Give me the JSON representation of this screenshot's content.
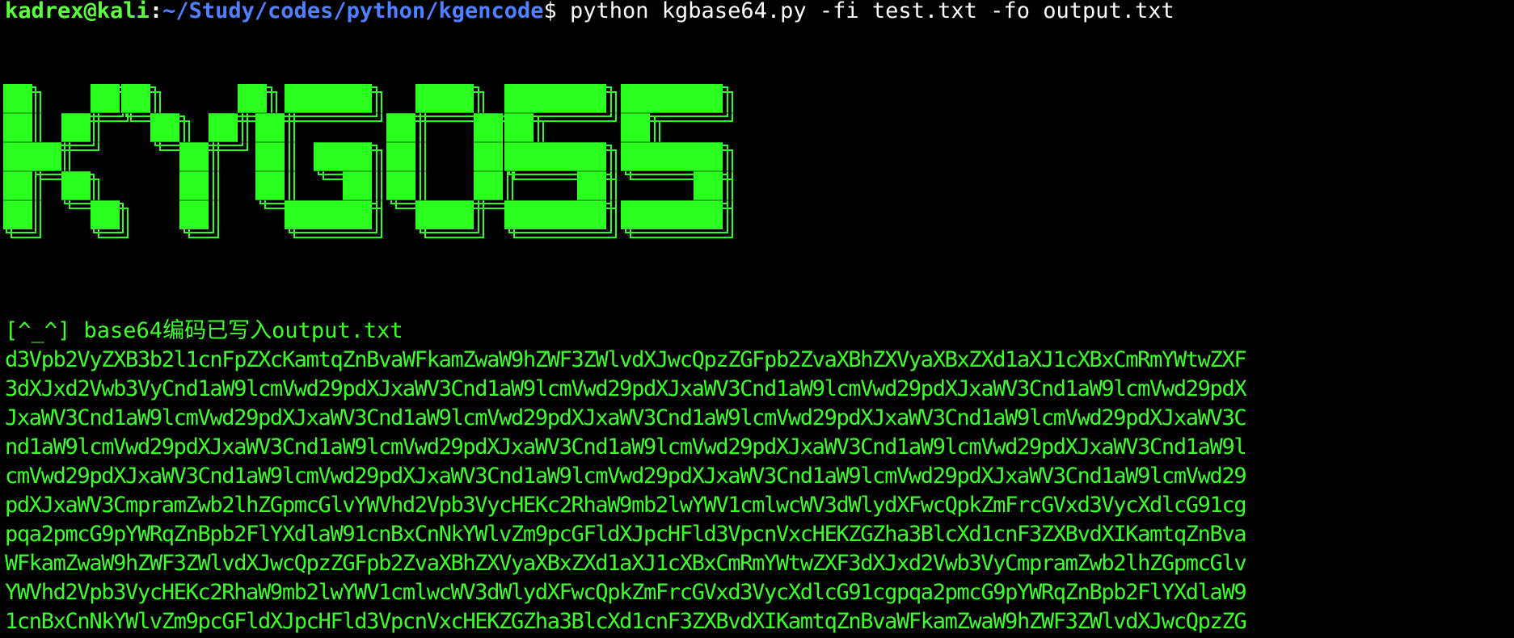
{
  "terminal": {
    "prompt": {
      "user_host": "kadrex@kali",
      "sep": ":",
      "path": "~/Study/codes/python/kgencode",
      "dollar": "$",
      "command": " python kgbase64.py -fi test.txt -fo output.txt"
    },
    "banner": {
      "text": "KYGOSS",
      "color": "#2aff20"
    },
    "status": "[^_^] base64编码已写入output.txt",
    "output_lines": [
      "d3Vpb2VyZXB3b2l1cnFpZXcKamtqZnBvaWFkamZwaW9hZWF3ZWlvdXJwcQpzZGFpb2ZvaXBhZXVyaXBxZXd1aXJ1cXBxCmRmYWtwZXF",
      "3dXJxd2Vwb3VyCnd1aW9lcmVwd29pdXJxaWV3Cnd1aW9lcmVwd29pdXJxaWV3Cnd1aW9lcmVwd29pdXJxaWV3Cnd1aW9lcmVwd29pdX",
      "JxaWV3Cnd1aW9lcmVwd29pdXJxaWV3Cnd1aW9lcmVwd29pdXJxaWV3Cnd1aW9lcmVwd29pdXJxaWV3Cnd1aW9lcmVwd29pdXJxaWV3C",
      "nd1aW9lcmVwd29pdXJxaWV3Cnd1aW9lcmVwd29pdXJxaWV3Cnd1aW9lcmVwd29pdXJxaWV3Cnd1aW9lcmVwd29pdXJxaWV3Cnd1aW9l",
      "cmVwd29pdXJxaWV3Cnd1aW9lcmVwd29pdXJxaWV3Cnd1aW9lcmVwd29pdXJxaWV3Cnd1aW9lcmVwd29pdXJxaWV3Cnd1aW9lcmVwd29",
      "pdXJxaWV3CmpramZwb2lhZGpmcGlvYWVhd2Vpb3VycHEKc2RhaW9mb2lwYWV1cmlwcWV3dWlydXFwcQpkZmFrcGVxd3VycXdlcG91cg",
      "pqa2pmcG9pYWRqZnBpb2FlYXdlaW91cnBxCnNkYWlvZm9pcGFldXJpcHFld3VpcnVxcHEKZGZha3BlcXd1cnF3ZXBvdXIKamtqZnBva",
      "WFkamZwaW9hZWF3ZWlvdXJwcQpzZGFpb2ZvaXBhZXVyaXBxZXd1aXJ1cXBxCmRmYWtwZXF3dXJxd2Vwb3VyCmpramZwb2lhZGpmcGlv",
      "YWVhd2Vpb3VycHEKc2RhaW9mb2lwYWV1cmlwcWV3dWlydXFwcQpkZmFrcGVxd3VycXdlcG91cgpqa2pmcG9pYWRqZnBpb2FlYXdlaW9",
      "1cnBxCnNkYWlvZm9pcGFldXJpcHFld3VpcnVxcHEKZGZha3BlcXd1cnF3ZXBvdXIKamtqZnBvaWFkamZwaW9hZWF3ZWlvdXJwcQpzZG"
    ]
  }
}
